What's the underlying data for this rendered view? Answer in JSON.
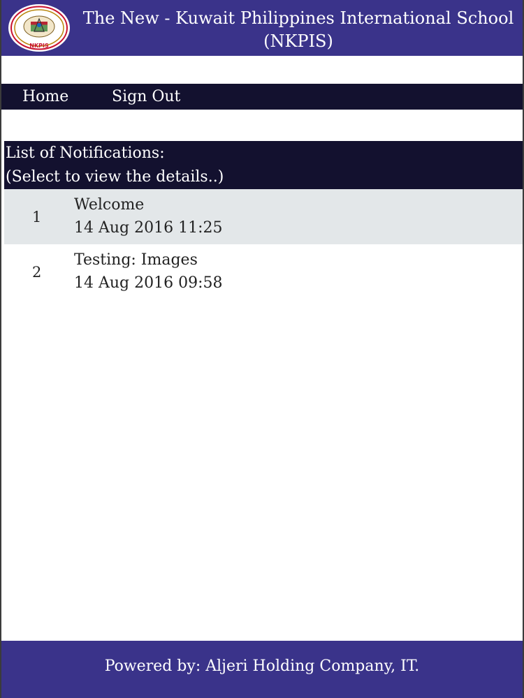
{
  "header": {
    "title_line1": "The New - Kuwait Philippines International School",
    "title_line2": "(NKPIS)",
    "logo_text": "NKPIS"
  },
  "nav": {
    "home": "Home",
    "sign_out": "Sign Out"
  },
  "notifications": {
    "heading_line1": "List of Notifications:",
    "heading_line2": "(Select to view the details..)",
    "items": [
      {
        "index": "1",
        "title": "Welcome",
        "date": "14 Aug 2016 11:25"
      },
      {
        "index": "2",
        "title": "Testing: Images",
        "date": "14 Aug 2016 09:58"
      }
    ]
  },
  "footer": {
    "text": "Powered by: Aljeri Holding Company, IT."
  },
  "colors": {
    "header_bg": "#3a338a",
    "nav_bg": "#13112f",
    "selected_row_bg": "#e3e7e9"
  }
}
